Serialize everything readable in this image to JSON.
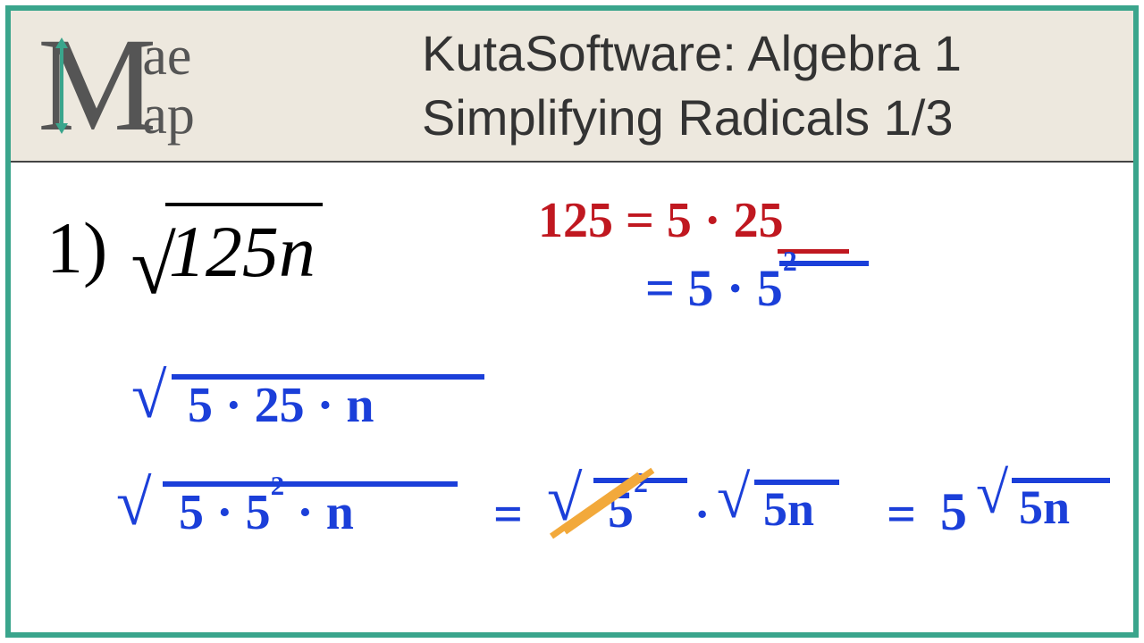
{
  "logo": {
    "top": "ae",
    "bottom": "ap"
  },
  "title": {
    "line1": "KutaSoftware: Algebra 1",
    "line2": "Simplifying Radicals 1/3"
  },
  "problem": {
    "number": "1)",
    "radicand": "125n"
  },
  "work": {
    "fact1": "125 = 5 · 25",
    "fact2": "= 5 · 5",
    "fact2_sup": "2",
    "line1_rad": "5 · 25 · n",
    "line2_rad": "5 · 5",
    "line2_sup": "2",
    "line2_tail": " · n",
    "eq_mid": "=",
    "mid_rad": "5",
    "mid_sup": "2",
    "mid_dot": "·",
    "mid_rad2": "5n",
    "eq_r": "=",
    "final_coef": "5",
    "final_rad": "5n"
  }
}
